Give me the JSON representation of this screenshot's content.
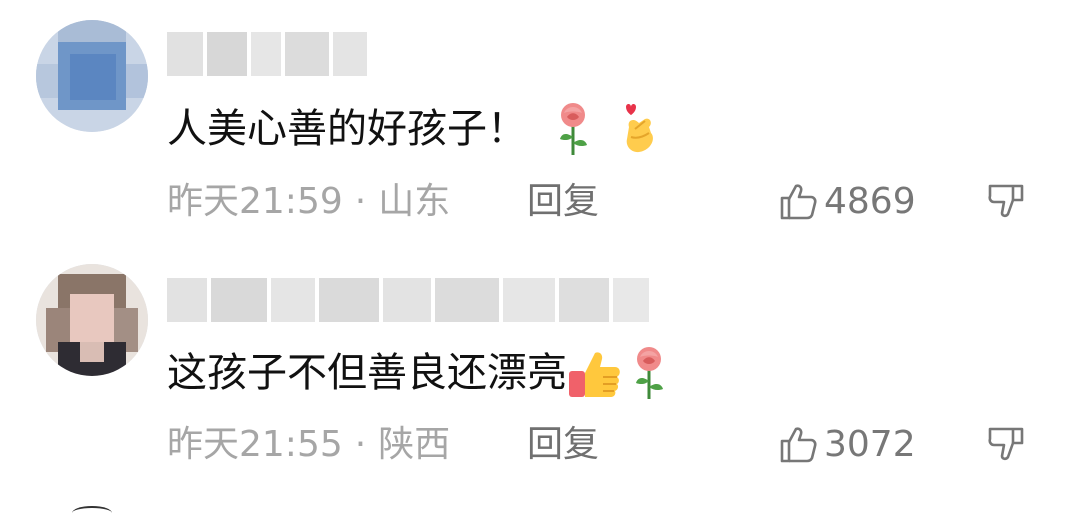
{
  "comments": [
    {
      "text": "人美心善的好孩子！",
      "emojis": [
        "rose-emoji",
        "finger-heart-emoji"
      ],
      "time": "昨天21:59",
      "separator": "·",
      "location": "山东",
      "reply_label": "回复",
      "likes": "4869"
    },
    {
      "text": "这孩子不但善良还漂亮",
      "emojis": [
        "thumbs-up-emoji",
        "rose-emoji"
      ],
      "time": "昨天21:55",
      "separator": "·",
      "location": "陕西",
      "reply_label": "回复",
      "likes": "3072"
    }
  ],
  "colors": {
    "text_primary": "#111111",
    "text_meta": "#a6a6a6",
    "icon": "#777777"
  }
}
